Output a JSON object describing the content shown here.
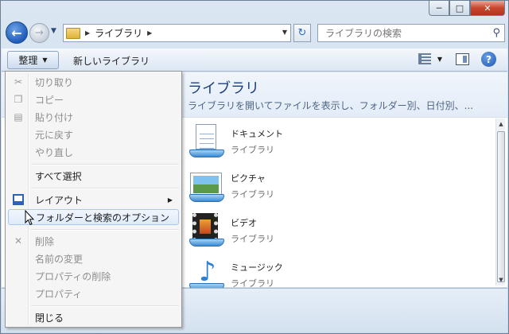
{
  "window": {
    "min_label": "─",
    "max_label": "□",
    "close_label": "✕"
  },
  "nav": {
    "back_glyph": "←",
    "forward_glyph": "→",
    "recent_glyph": "▼",
    "breadcrumb": [
      "ライブラリ"
    ],
    "crumb_sep": "▶",
    "dropdown_glyph": "▼",
    "refresh_glyph": "↻",
    "search_placeholder": "ライブラリの検索",
    "search_icon": "search-icon"
  },
  "toolbar": {
    "organize_label": "整理",
    "organize_arrow": "▼",
    "new_library_label": "新しいライブラリ",
    "view_arrow": "▼",
    "help_label": "?"
  },
  "library": {
    "title": "ライブラリ",
    "description": "ライブラリを開いてファイルを表示し、フォルダー別、日付別、..."
  },
  "items": [
    {
      "name": "ドキュメント",
      "type": "ライブラリ",
      "icon": "documents-icon"
    },
    {
      "name": "ピクチャ",
      "type": "ライブラリ",
      "icon": "pictures-icon"
    },
    {
      "name": "ビデオ",
      "type": "ライブラリ",
      "icon": "videos-icon"
    },
    {
      "name": "ミュージック",
      "type": "ライブラリ",
      "icon": "music-icon"
    }
  ],
  "menu": {
    "cut": "切り取り",
    "copy": "コピー",
    "paste": "貼り付け",
    "undo": "元に戻す",
    "redo": "やり直し",
    "select_all": "すべて選択",
    "layout": "レイアウト",
    "layout_arrow": "▶",
    "folder_options": "フォルダーと検索のオプション",
    "delete": "削除",
    "rename": "名前の変更",
    "remove_properties": "プロパティの削除",
    "properties": "プロパティ",
    "close": "閉じる"
  },
  "scroll": {
    "up": "▲",
    "down": "▼"
  }
}
